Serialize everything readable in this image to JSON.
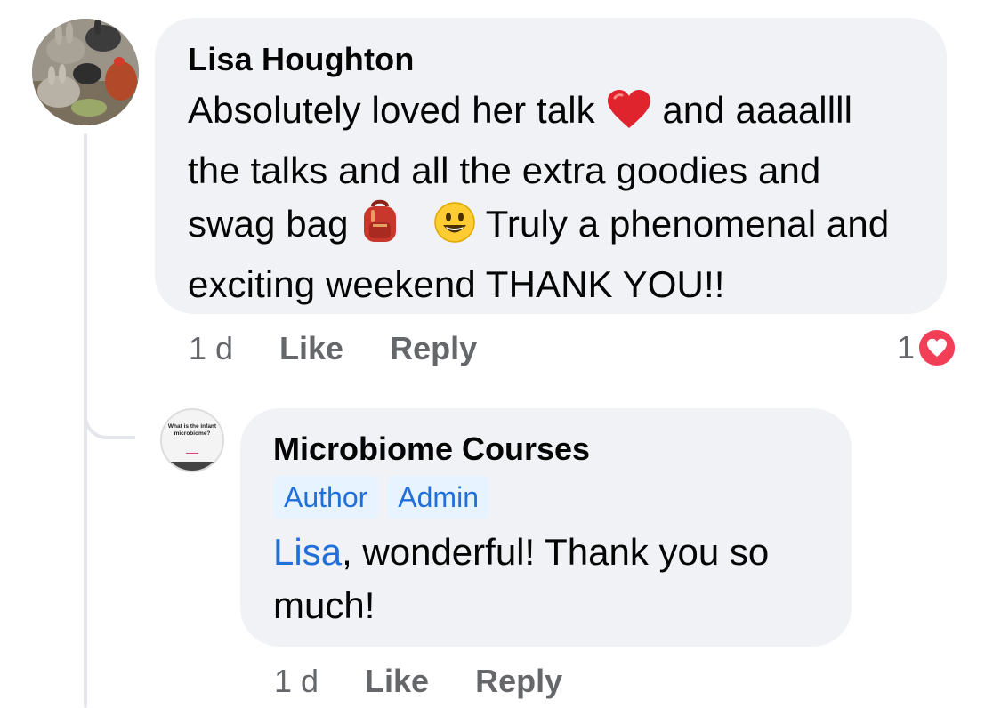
{
  "comment_1": {
    "author": "Lisa Houghton",
    "text_part1": "Absolutely loved her talk",
    "text_part2": "and aaaallll the talks and all the extra goodies and swag bag",
    "text_part3": "Truly a phenomenal and exciting weekend THANK YOU!!",
    "emojis": [
      "red-heart-icon",
      "backpack-icon",
      "smiley-face-icon"
    ],
    "time": "1 d",
    "like_label": "Like",
    "reply_label": "Reply",
    "reaction_count": "1",
    "reaction_type": "love-icon"
  },
  "comment_2": {
    "author": "Microbiome Courses",
    "badges": [
      "Author",
      "Admin"
    ],
    "mention": "Lisa",
    "text": ", wonderful! Thank you so much!",
    "avatar_text": "What is the infant microbiome?",
    "time": "1 d",
    "like_label": "Like",
    "reply_label": "Reply"
  },
  "colors": {
    "bubble": "#f0f2f5",
    "meta_text": "#65676b",
    "link": "#216fdb",
    "love": "#f33e58",
    "badge_bg": "#e7f3ff"
  }
}
